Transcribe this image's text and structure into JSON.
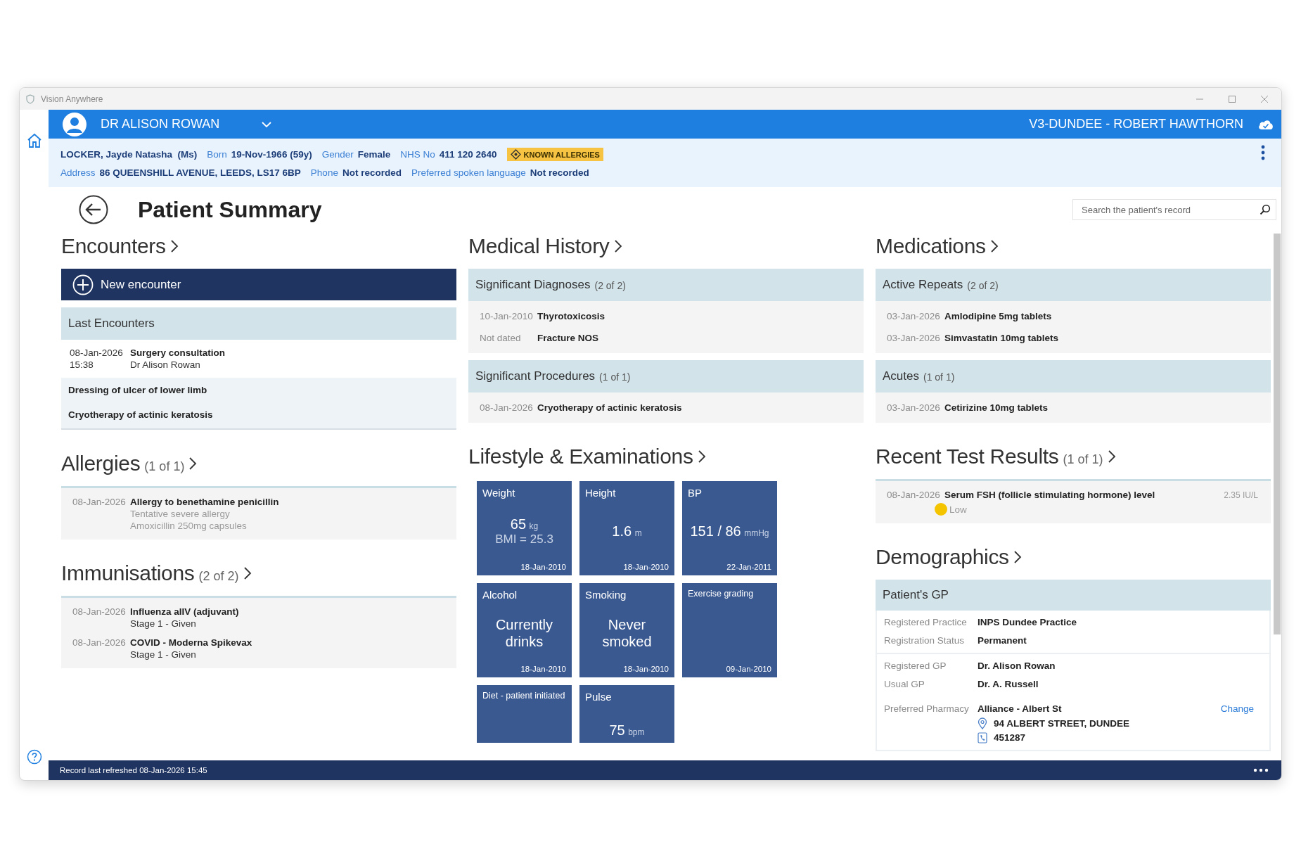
{
  "window": {
    "title": "Vision Anywhere"
  },
  "header": {
    "user": "DR ALISON ROWAN",
    "location": "V3-DUNDEE - ROBERT HAWTHORN"
  },
  "patient": {
    "name": "LOCKER, Jayde Natasha  (Ms)",
    "line1": [
      {
        "label": "Born",
        "value": "19-Nov-1966 (59y)"
      },
      {
        "label": "Gender",
        "value": "Female"
      },
      {
        "label": "NHS No",
        "value": "411 120 2640"
      }
    ],
    "badge": "KNOWN ALLERGIES",
    "line2": [
      {
        "label": "Address",
        "value": "86 QUEENSHILL AVENUE, LEEDS, LS17 6BP"
      },
      {
        "label": "Phone",
        "value": "Not recorded"
      },
      {
        "label": "Preferred spoken language",
        "value": "Not recorded"
      }
    ]
  },
  "page": {
    "title": "Patient Summary",
    "search": {
      "placeholder": "Search the patient's record"
    }
  },
  "columns": [
    {
      "sections": [
        {
          "heading": "Encounters",
          "blocks": [
            {
              "kind": "button",
              "label": "New encounter"
            },
            {
              "kind": "panel",
              "title": "Last Encounters",
              "rows": [
                {
                  "kind": "encounter",
                  "date": "08-Jan-2026",
                  "time": "15:38",
                  "title": "Surgery consultation",
                  "detail": "Dr Alison Rowan"
                },
                {
                  "kind": "note",
                  "title": "Dressing of ulcer of lower limb"
                },
                {
                  "kind": "note",
                  "title": "Cryotherapy of actinic keratosis"
                }
              ]
            }
          ]
        },
        {
          "heading": "Allergies",
          "count": "(1 of 1)",
          "blocks": [
            {
              "kind": "panel",
              "rows": [
                {
                  "kind": "allergy",
                  "date": "08-Jan-2026",
                  "title": "Allergy to benethamine penicillin",
                  "lines": [
                    "Tentative severe allergy",
                    "Amoxicillin 250mg capsules"
                  ]
                }
              ]
            }
          ]
        },
        {
          "heading": "Immunisations",
          "count": "(2 of 2)",
          "blocks": [
            {
              "kind": "panel",
              "rows": [
                {
                  "kind": "immunisation",
                  "date": "08-Jan-2026",
                  "title": "Influenza aIIV (adjuvant)",
                  "lines": [
                    "Stage 1 - Given"
                  ]
                },
                {
                  "kind": "immunisation",
                  "date": "08-Jan-2026",
                  "title": "COVID - Moderna Spikevax",
                  "lines": [
                    "Stage 1 - Given"
                  ]
                }
              ]
            }
          ]
        }
      ]
    },
    {
      "sections": [
        {
          "heading": "Medical History",
          "blocks": [
            {
              "kind": "panel",
              "title": "Significant Diagnoses",
              "count": "(2 of 2)",
              "rows": [
                {
                  "kind": "entry",
                  "date": "10-Jan-2010",
                  "title": "Thyrotoxicosis"
                },
                {
                  "kind": "entry",
                  "date": "Not dated",
                  "title": "Fracture NOS"
                }
              ]
            },
            {
              "kind": "panel",
              "title": "Significant Procedures",
              "count": "(1 of 1)",
              "rows": [
                {
                  "kind": "entry",
                  "date": "08-Jan-2026",
                  "title": "Cryotherapy of actinic keratosis"
                }
              ]
            }
          ]
        },
        {
          "heading": "Lifestyle & Examinations",
          "blocks": [
            {
              "kind": "tiles",
              "tiles": [
                {
                  "label": "Weight",
                  "value": "65",
                  "unit": "kg",
                  "sub": "BMI = 25.3",
                  "date": "18-Jan-2010"
                },
                {
                  "label": "Height",
                  "value": "1.6",
                  "unit": "m",
                  "date": "18-Jan-2010"
                },
                {
                  "label": "BP",
                  "value": "151 / 86",
                  "unit": "mmHg",
                  "date": "22-Jan-2011"
                },
                {
                  "label": "Alcohol",
                  "value": "Currently drinks",
                  "date": "18-Jan-2010"
                },
                {
                  "label": "Smoking",
                  "value": "Never smoked",
                  "date": "18-Jan-2010"
                },
                {
                  "label": "Exercise grading",
                  "date": "09-Jan-2010"
                },
                {
                  "label": "Diet - patient initiated"
                },
                {
                  "label": "Pulse",
                  "value": "75",
                  "unit": "bpm"
                }
              ]
            }
          ]
        }
      ]
    },
    {
      "sections": [
        {
          "heading": "Medications",
          "blocks": [
            {
              "kind": "panel",
              "title": "Active Repeats",
              "count": "(2 of 2)",
              "rows": [
                {
                  "kind": "entry",
                  "date": "03-Jan-2026",
                  "title": "Amlodipine 5mg tablets"
                },
                {
                  "kind": "entry",
                  "date": "03-Jan-2026",
                  "title": "Simvastatin 10mg tablets"
                }
              ]
            },
            {
              "kind": "panel",
              "title": "Acutes",
              "count": "(1 of 1)",
              "rows": [
                {
                  "kind": "entry",
                  "date": "03-Jan-2026",
                  "title": "Cetirizine 10mg tablets"
                }
              ]
            }
          ]
        },
        {
          "heading": "Recent Test Results",
          "count": "(1 of 1)",
          "blocks": [
            {
              "kind": "panel",
              "rows": [
                {
                  "kind": "result",
                  "date": "08-Jan-2026",
                  "title": "Serum FSH (follicle stimulating hormone) level",
                  "value": "2.35 IU/L",
                  "flag": "Low",
                  "color": "#f5c400"
                }
              ]
            }
          ]
        },
        {
          "heading": "Demographics",
          "blocks": [
            {
              "kind": "details",
              "title": "Patient's GP",
              "groups": [
                {
                  "fields": [
                    {
                      "label": "Registered Practice",
                      "value": "INPS Dundee Practice"
                    },
                    {
                      "label": "Registration Status",
                      "value": "Permanent"
                    }
                  ]
                },
                {
                  "fields": [
                    {
                      "label": "Registered GP",
                      "value": "Dr. Alison Rowan"
                    },
                    {
                      "label": "Usual GP",
                      "value": "Dr. A. Russell"
                    },
                    {
                      "label": "Preferred Pharmacy",
                      "value": "Alliance - Albert St",
                      "action": "Change",
                      "address": "94 ALBERT STREET, DUNDEE",
                      "phone": "451287"
                    }
                  ]
                }
              ]
            }
          ]
        }
      ]
    }
  ],
  "status_bar": {
    "text": "Record last refreshed 08-Jan-2026 15:45"
  }
}
